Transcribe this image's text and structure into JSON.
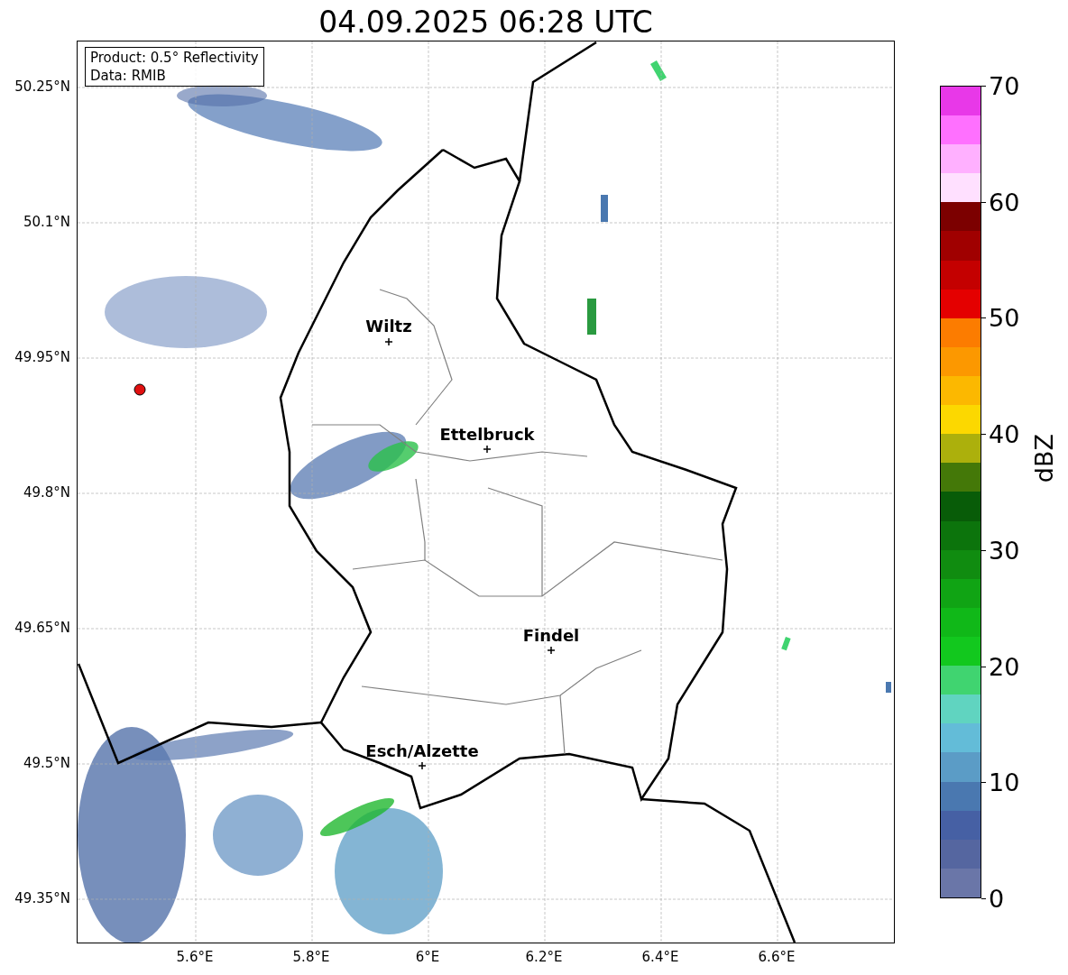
{
  "title": "04.09.2025 06:28 UTC",
  "legend": {
    "lines": [
      "Product: 0.5° Reflectivity",
      "Data: RMIB"
    ]
  },
  "map": {
    "y_ticks": [
      "50.25°N",
      "50.1°N",
      "49.95°N",
      "49.8°N",
      "49.65°N",
      "49.5°N",
      "49.35°N"
    ],
    "x_ticks": [
      "5.6°E",
      "5.8°E",
      "6°E",
      "6.2°E",
      "6.4°E",
      "6.6°E"
    ],
    "cities": [
      {
        "name": "Wiltz"
      },
      {
        "name": "Ettelbruck"
      },
      {
        "name": "Findel"
      },
      {
        "name": "Esch/Alzette"
      }
    ]
  },
  "colorbar": {
    "label": "dBZ",
    "ticks": [
      "70",
      "60",
      "50",
      "40",
      "30",
      "20",
      "10",
      "0"
    ],
    "segments": [
      {
        "color": "#6a76a8"
      },
      {
        "color": "#5566a0"
      },
      {
        "color": "#4660a4"
      },
      {
        "color": "#4a78b0"
      },
      {
        "color": "#5b9cc6"
      },
      {
        "color": "#63bcd8"
      },
      {
        "color": "#60d4c0"
      },
      {
        "color": "#40d470"
      },
      {
        "color": "#12c81e"
      },
      {
        "color": "#10b818"
      },
      {
        "color": "#10a414"
      },
      {
        "color": "#108c10"
      },
      {
        "color": "#0c740c"
      },
      {
        "color": "#085c08"
      },
      {
        "color": "#447808"
      },
      {
        "color": "#acb00c"
      },
      {
        "color": "#fcd800"
      },
      {
        "color": "#fcb800"
      },
      {
        "color": "#fc9800"
      },
      {
        "color": "#fc7c00"
      },
      {
        "color": "#e40000"
      },
      {
        "color": "#c40000"
      },
      {
        "color": "#a00000"
      },
      {
        "color": "#7c0000"
      },
      {
        "color": "#ffe0ff"
      },
      {
        "color": "#ffb0ff"
      },
      {
        "color": "#ff70ff"
      },
      {
        "color": "#e838e8"
      }
    ]
  }
}
